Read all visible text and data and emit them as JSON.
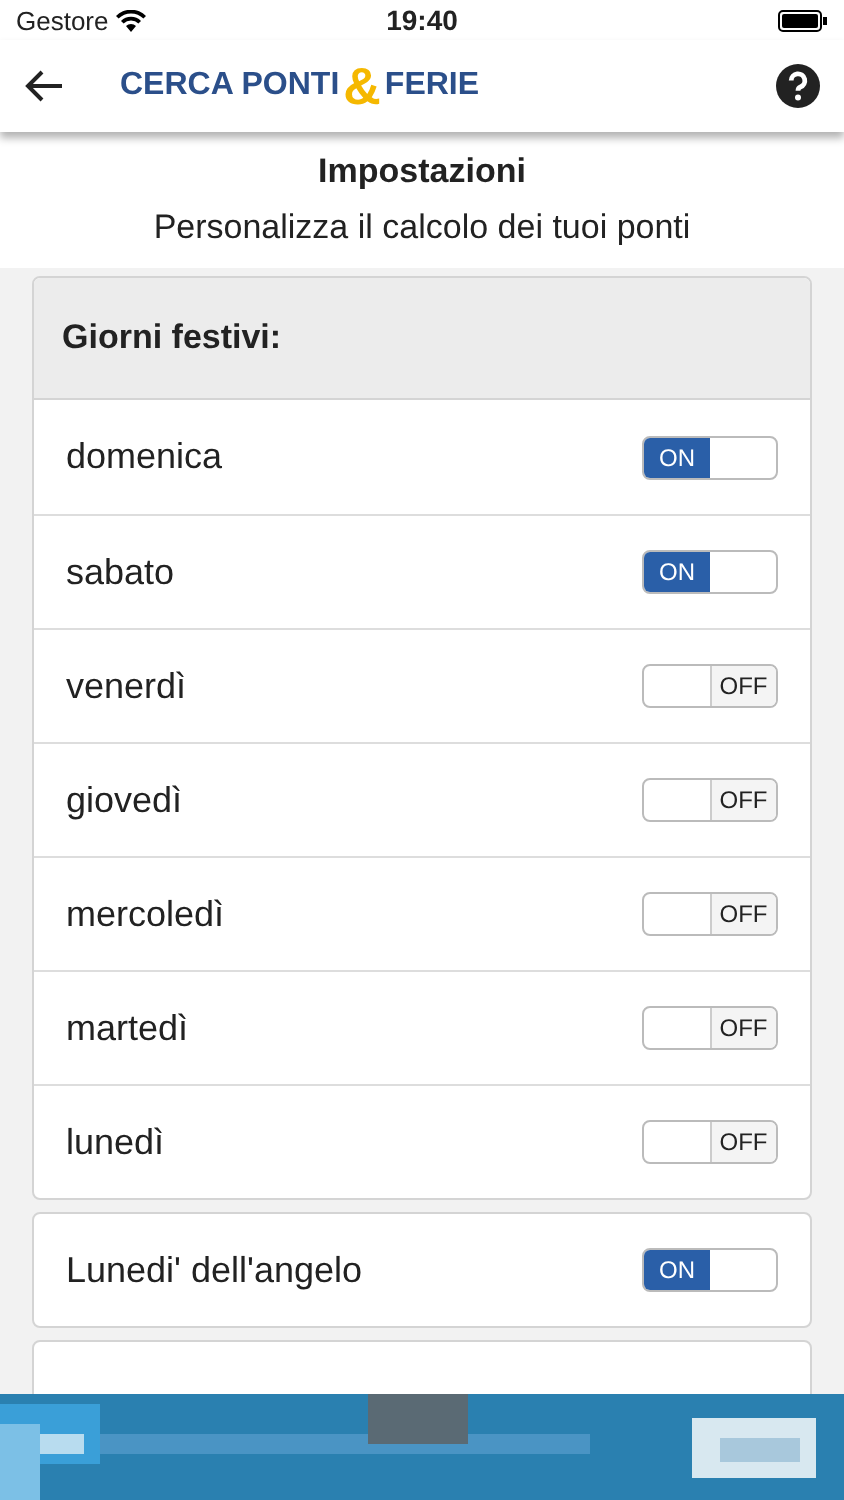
{
  "status_bar": {
    "carrier": "Gestore",
    "time": "19:40"
  },
  "header": {
    "logo_left": "CERCA PONTI",
    "logo_amp": "&",
    "logo_right": "FERIE"
  },
  "title": "Impostazioni",
  "subtitle": "Personalizza il calcolo dei tuoi ponti",
  "holidays_card": {
    "heading": "Giorni festivi:",
    "rows": [
      {
        "label": "domenica",
        "on": true,
        "on_text": "ON"
      },
      {
        "label": "sabato",
        "on": true,
        "on_text": "ON"
      },
      {
        "label": "venerdì",
        "on": false,
        "off_text": "OFF"
      },
      {
        "label": "giovedì",
        "on": false,
        "off_text": "OFF"
      },
      {
        "label": "mercoledì",
        "on": false,
        "off_text": "OFF"
      },
      {
        "label": "martedì",
        "on": false,
        "off_text": "OFF"
      },
      {
        "label": "lunedì",
        "on": false,
        "off_text": "OFF"
      }
    ]
  },
  "easter_card": {
    "label": "Lunedi' dell'angelo",
    "on": true,
    "on_text": "ON"
  }
}
